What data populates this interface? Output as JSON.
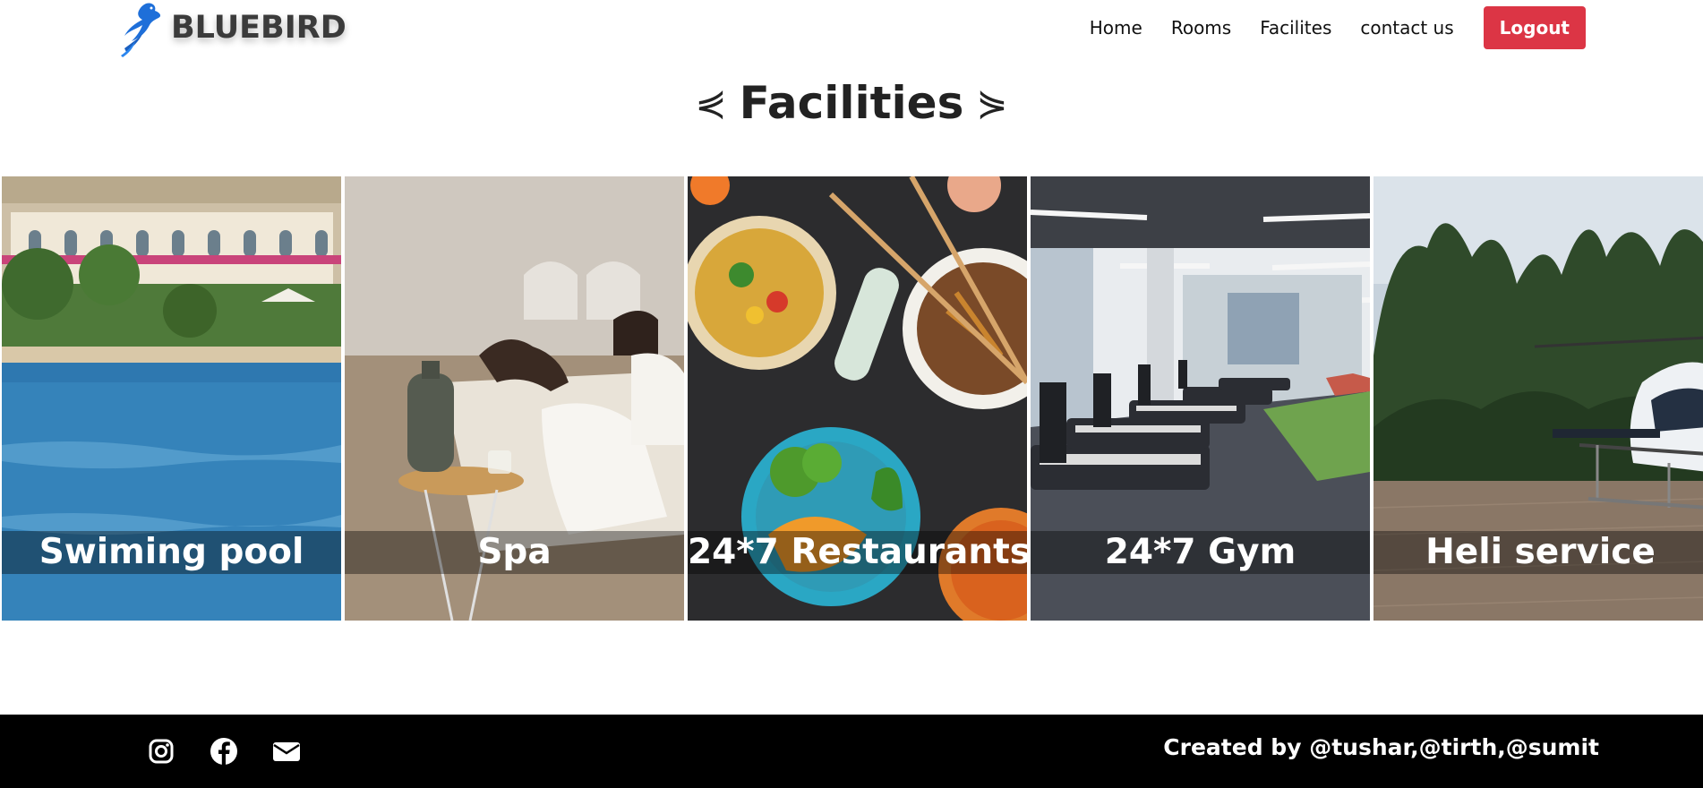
{
  "brand": {
    "logo_icon": "bird-logo-icon",
    "name": "BLUEBIRD"
  },
  "nav": {
    "items": [
      {
        "label": "Home"
      },
      {
        "label": "Rooms"
      },
      {
        "label": "Facilites"
      },
      {
        "label": "contact us"
      }
    ],
    "logout_label": "Logout",
    "logout_color": "#dc3545"
  },
  "section": {
    "title": "Facilities",
    "left_decoration": "⋞",
    "right_decoration": "⋟"
  },
  "facilities": [
    {
      "label": "Swiming pool",
      "icon": "pool-photo"
    },
    {
      "label": "Spa",
      "icon": "spa-photo"
    },
    {
      "label": "24*7 Restaurants",
      "icon": "restaurant-photo"
    },
    {
      "label": "24*7 Gym",
      "icon": "gym-photo"
    },
    {
      "label": "Heli service",
      "icon": "helicopter-photo"
    }
  ],
  "footer": {
    "social": [
      "instagram-icon",
      "facebook-icon",
      "email-icon"
    ],
    "credits": "Created by @tushar,@tirth,@sumit",
    "background": "#000000"
  }
}
